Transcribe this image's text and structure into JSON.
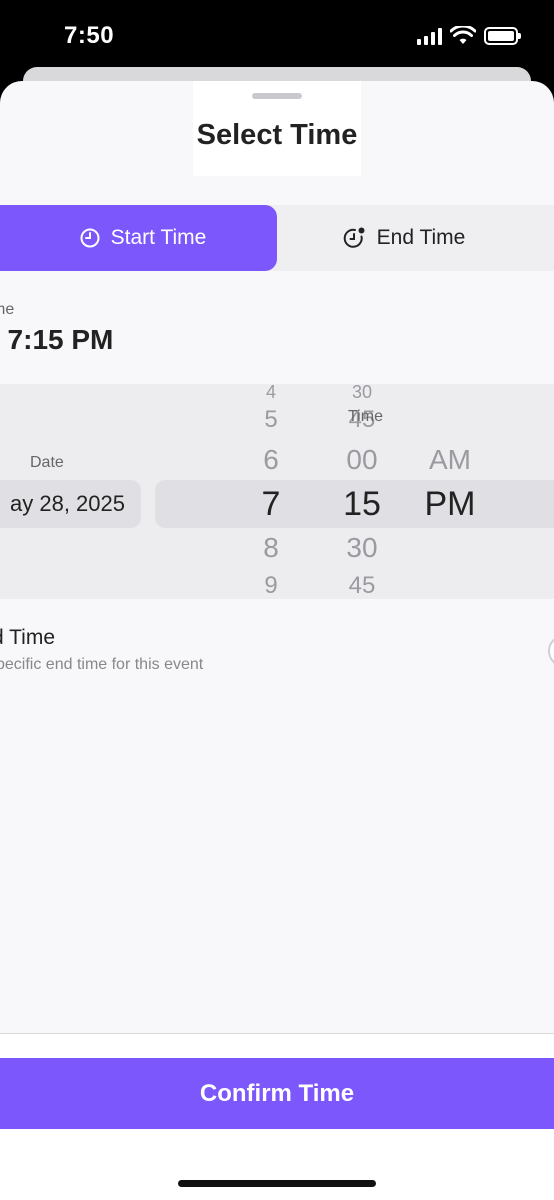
{
  "status_bar": {
    "time": "7:50"
  },
  "sheet": {
    "title": "Select Time"
  },
  "tabs": [
    {
      "label": "Start Time",
      "icon": "clock-icon",
      "active": true
    },
    {
      "label": "End Time",
      "icon": "clock-badge-icon",
      "active": false
    }
  ],
  "summary": {
    "label": "me",
    "value": ", 7:15 PM"
  },
  "picker": {
    "date_label": "Date",
    "date_value": "ay 28, 2025",
    "time_label": "Time",
    "hours": [
      "4",
      "5",
      "6",
      "7",
      "8",
      "9"
    ],
    "minutes": [
      "30",
      "45",
      "00",
      "15",
      "30",
      "45"
    ],
    "ampm": [
      "AM",
      "PM"
    ],
    "selected": {
      "hour": "7",
      "minute": "15",
      "ampm": "PM"
    }
  },
  "toggle": {
    "title": "d Time",
    "description": "pecific end time for this event"
  },
  "footer": {
    "confirm_label": "Confirm Time"
  },
  "colors": {
    "accent": "#7c57fc",
    "background": "#f8f8fa"
  }
}
